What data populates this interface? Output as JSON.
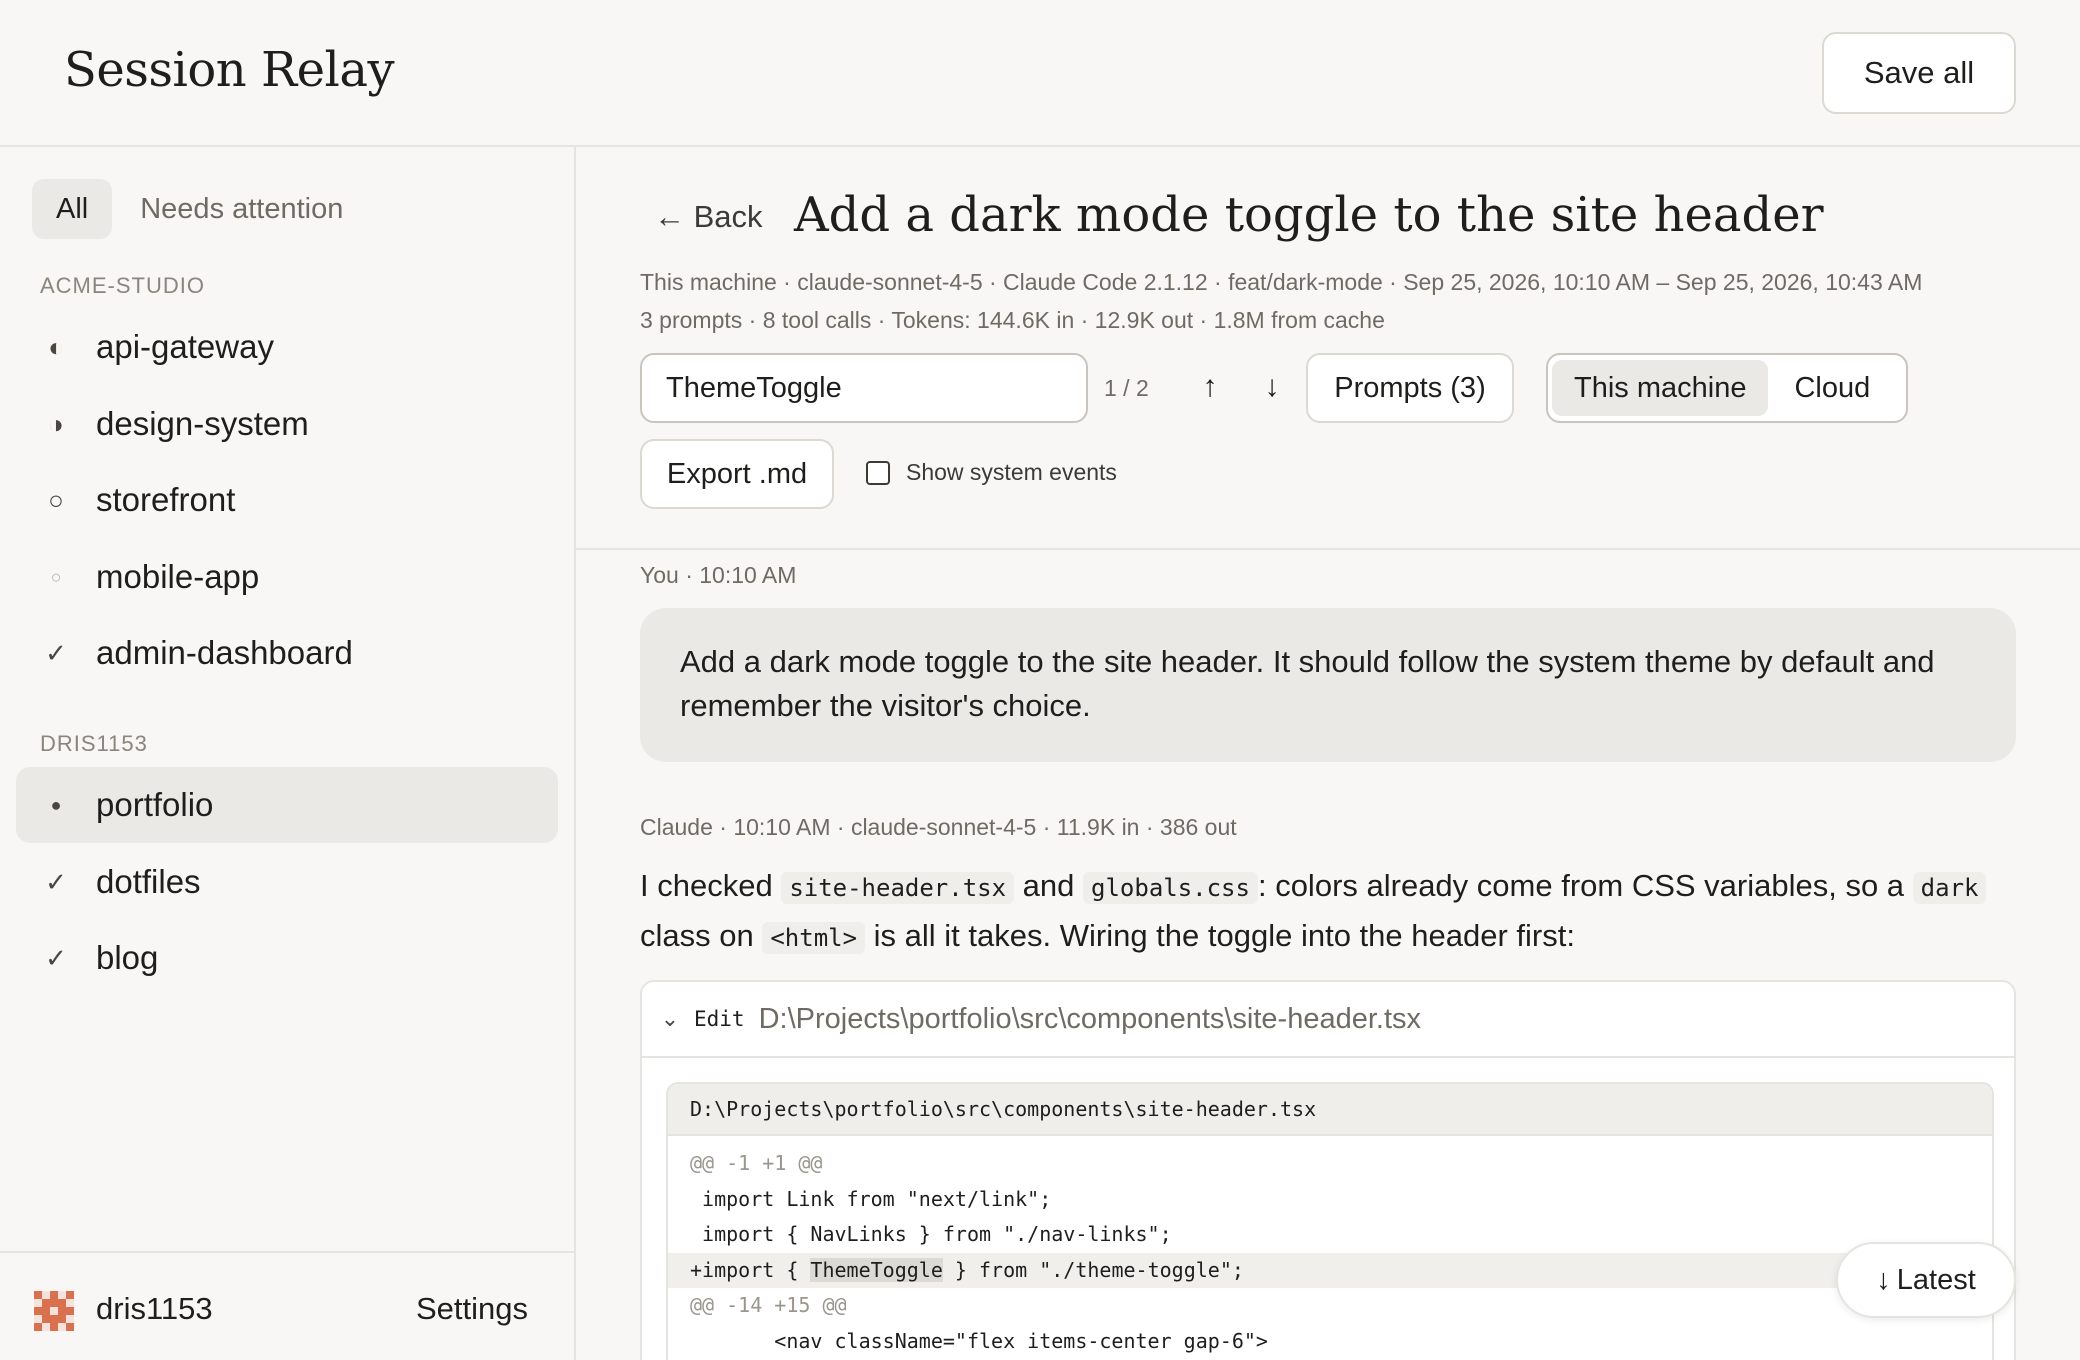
{
  "app": {
    "title": "Session Relay",
    "save_all": "Save all"
  },
  "sidebar": {
    "filters": [
      {
        "label": "All",
        "active": true
      },
      {
        "label": "Needs attention",
        "active": false
      }
    ],
    "groups": [
      {
        "label": "ACME-STUDIO",
        "projects": [
          {
            "name": "api-gateway",
            "status": "◐"
          },
          {
            "name": "design-system",
            "status": "◑"
          },
          {
            "name": "storefront",
            "status": "○"
          },
          {
            "name": "mobile-app",
            "status": "○"
          },
          {
            "name": "admin-dashboard",
            "status": "✓"
          }
        ]
      },
      {
        "label": "DRIS1153",
        "projects": [
          {
            "name": "portfolio",
            "status": "●",
            "selected": true
          },
          {
            "name": "dotfiles",
            "status": "✓"
          },
          {
            "name": "blog",
            "status": "✓"
          }
        ]
      }
    ],
    "footer": {
      "username": "dris1153",
      "settings": "Settings"
    }
  },
  "session": {
    "back": "← Back",
    "title": "Add a dark mode toggle to the site header",
    "meta1": "This machine · claude-sonnet-4-5 · Claude Code 2.1.12 · feat/dark-mode · Sep 25, 2026, 10:10 AM – Sep 25, 2026, 10:43 AM",
    "meta2": "3 prompts · 8 tool calls · Tokens: 144.6K in · 12.9K out · 1.8M from cache",
    "search_value": "ThemeToggle",
    "match_count": "1 / 2",
    "prev_icon": "↑",
    "next_icon": "↓",
    "prompts_button": "Prompts (3)",
    "source_options": [
      {
        "label": "This machine",
        "active": true
      },
      {
        "label": "Cloud",
        "active": false
      }
    ],
    "export_button": "Export .md",
    "system_events_label": "Show system events"
  },
  "transcript": {
    "user_meta": "You · 10:10 AM",
    "user_text": "Add a dark mode toggle to the site header. It should follow the system theme by default and remember the visitor's choice.",
    "assistant_meta": "Claude · 10:10 AM · claude-sonnet-4-5 · 11.9K in · 386 out",
    "assistant_parts": {
      "p1": "I checked ",
      "c1": "site-header.tsx",
      "p2": " and ",
      "c2": "globals.css",
      "p3": ": colors already come from CSS variables, so a ",
      "c3": "dark",
      "p4": " class on ",
      "c4": "<html>",
      "p5": " is all it takes. Wiring the toggle into the header first:"
    },
    "tool": {
      "kind": "Edit",
      "path": "D:\\Projects\\portfolio\\src\\components\\site-header.tsx",
      "diff_header": "D:\\Projects\\portfolio\\src\\components\\site-header.tsx",
      "lines": [
        {
          "text": "@@ -1 +1 @@",
          "type": "hunk"
        },
        {
          "text": " import Link from \"next/link\";",
          "type": "ctx"
        },
        {
          "text": " import { NavLinks } from \"./nav-links\";",
          "type": "ctx"
        },
        {
          "pre": "+import { ",
          "match": "ThemeToggle",
          "post": " } from \"./theme-toggle\";",
          "type": "add"
        },
        {
          "text": "@@ -14 +15 @@",
          "type": "hunk"
        },
        {
          "text": "       <nav className=\"flex items-center gap-6\">",
          "type": "ctx"
        }
      ]
    },
    "latest_button": "Latest",
    "latest_icon": "↓"
  }
}
